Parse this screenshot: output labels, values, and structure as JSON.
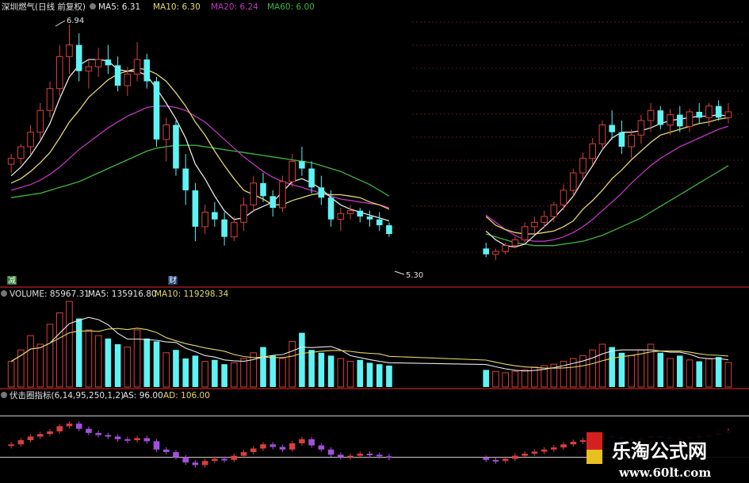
{
  "colors": {
    "up": "#d8403e",
    "down": "#5ff3f3",
    "ma5": "#e8e8e8",
    "ma10": "#e5d96a",
    "ma20": "#c235c2",
    "ma60": "#3fb53f",
    "divider": "#9b1b1b",
    "ref_line": "#d8d8d8",
    "as_purple": "#a34fdc"
  },
  "header": {
    "stock": "深圳燃气(日线 前复权)",
    "ma5": "MA5: 6.31",
    "ma10": "MA10: 6.30",
    "ma20": "MA20: 6.24",
    "ma60": "MA60: 6.00"
  },
  "price_panel": {
    "high_label": "6.94",
    "low_label": "5.30",
    "marker_left": "减",
    "marker_mid": "财"
  },
  "volume_header": {
    "volume": "VOLUME: 85967.31",
    "ma5": "MA5: 135916.80",
    "ma10": "MA10: 119298.34"
  },
  "indicator_header": {
    "name": "伏击圈指标(6,14,95,250,1,2)",
    "as": "AS: 96.00",
    "ad": "AD: 106.00"
  },
  "watermark": {
    "title": "乐淘公式网",
    "url": "www.60lt.com"
  },
  "chart_data": [
    {
      "type": "candlestick",
      "ylim": [
        5.2,
        7.0
      ],
      "annotations": [
        {
          "label": "6.94",
          "value": 6.94
        },
        {
          "label": "5.30",
          "value": 5.3
        }
      ],
      "candles": [
        [
          5.98,
          6.05,
          5.92,
          6.02
        ],
        [
          6.02,
          6.12,
          5.98,
          6.1
        ],
        [
          6.1,
          6.25,
          6.05,
          6.2
        ],
        [
          6.2,
          6.4,
          6.15,
          6.35
        ],
        [
          6.35,
          6.55,
          6.3,
          6.5
        ],
        [
          6.5,
          6.8,
          6.45,
          6.72
        ],
        [
          6.72,
          6.94,
          6.6,
          6.8
        ],
        [
          6.8,
          6.88,
          6.55,
          6.62
        ],
        [
          6.62,
          6.7,
          6.5,
          6.65
        ],
        [
          6.65,
          6.78,
          6.58,
          6.7
        ],
        [
          6.7,
          6.8,
          6.6,
          6.66
        ],
        [
          6.66,
          6.72,
          6.48,
          6.52
        ],
        [
          6.52,
          6.65,
          6.45,
          6.6
        ],
        [
          6.6,
          6.82,
          6.55,
          6.7
        ],
        [
          6.7,
          6.74,
          6.5,
          6.55
        ],
        [
          6.55,
          6.58,
          6.1,
          6.15
        ],
        [
          6.15,
          6.3,
          6.0,
          6.25
        ],
        [
          6.25,
          6.28,
          5.9,
          5.95
        ],
        [
          5.95,
          6.05,
          5.7,
          5.8
        ],
        [
          5.8,
          5.85,
          5.45,
          5.55
        ],
        [
          5.55,
          5.7,
          5.5,
          5.65
        ],
        [
          5.65,
          5.72,
          5.55,
          5.6
        ],
        [
          5.6,
          5.65,
          5.42,
          5.48
        ],
        [
          5.48,
          5.62,
          5.45,
          5.58
        ],
        [
          5.58,
          5.75,
          5.52,
          5.7
        ],
        [
          5.7,
          5.9,
          5.65,
          5.85
        ],
        [
          5.85,
          5.92,
          5.72,
          5.76
        ],
        [
          5.76,
          5.8,
          5.62,
          5.68
        ],
        [
          5.68,
          5.9,
          5.65,
          5.86
        ],
        [
          5.86,
          6.05,
          5.82,
          6.0
        ],
        [
          6.0,
          6.1,
          5.9,
          5.95
        ],
        [
          5.95,
          6.0,
          5.78,
          5.82
        ],
        [
          5.82,
          5.9,
          5.7,
          5.75
        ],
        [
          5.75,
          5.8,
          5.55,
          5.6
        ],
        [
          5.6,
          5.68,
          5.52,
          5.64
        ],
        [
          5.64,
          5.7,
          5.6,
          5.66
        ],
        [
          5.66,
          5.68,
          5.58,
          5.62
        ],
        [
          5.62,
          5.66,
          5.55,
          5.6
        ],
        [
          5.6,
          5.65,
          5.52,
          5.56
        ],
        [
          5.56,
          5.58,
          5.48,
          5.5
        ],
        [
          5.4,
          5.44,
          5.34,
          5.36
        ],
        [
          5.36,
          5.4,
          5.32,
          5.38
        ],
        [
          5.38,
          5.44,
          5.36,
          5.42
        ],
        [
          5.42,
          5.48,
          5.4,
          5.46
        ],
        [
          5.46,
          5.58,
          5.44,
          5.55
        ],
        [
          5.55,
          5.62,
          5.5,
          5.58
        ],
        [
          5.58,
          5.66,
          5.54,
          5.62
        ],
        [
          5.62,
          5.72,
          5.58,
          5.7
        ],
        [
          5.7,
          5.84,
          5.66,
          5.8
        ],
        [
          5.8,
          5.95,
          5.76,
          5.92
        ],
        [
          5.92,
          6.06,
          5.88,
          6.02
        ],
        [
          6.02,
          6.16,
          5.98,
          6.12
        ],
        [
          6.12,
          6.28,
          6.08,
          6.25
        ],
        [
          6.25,
          6.35,
          6.15,
          6.2
        ],
        [
          6.2,
          6.28,
          6.05,
          6.1
        ],
        [
          6.1,
          6.22,
          6.02,
          6.18
        ],
        [
          6.18,
          6.32,
          6.12,
          6.28
        ],
        [
          6.28,
          6.4,
          6.2,
          6.35
        ],
        [
          6.35,
          6.38,
          6.22,
          6.25
        ],
        [
          6.25,
          6.36,
          6.18,
          6.32
        ],
        [
          6.32,
          6.38,
          6.2,
          6.24
        ],
        [
          6.24,
          6.36,
          6.2,
          6.34
        ],
        [
          6.34,
          6.4,
          6.26,
          6.3
        ],
        [
          6.3,
          6.4,
          6.24,
          6.38
        ],
        [
          6.38,
          6.42,
          6.28,
          6.3
        ],
        [
          6.3,
          6.4,
          6.26,
          6.34
        ]
      ],
      "gaps_after_index": [
        39
      ],
      "series": [
        {
          "name": "MA5",
          "values": [
            5.9,
            5.96,
            6.04,
            6.14,
            6.26,
            6.43,
            6.58,
            6.66,
            6.7,
            6.7,
            6.69,
            6.63,
            6.62,
            6.62,
            6.59,
            6.5,
            6.4,
            6.29,
            6.16,
            5.98,
            5.88,
            5.76,
            5.66,
            5.6,
            5.61,
            5.66,
            5.69,
            5.72,
            5.79,
            5.86,
            5.88,
            5.85,
            5.81,
            5.75,
            5.7,
            5.67,
            5.65,
            5.63,
            5.61,
            5.59,
            5.52,
            5.46,
            5.42,
            5.41,
            5.43,
            5.49,
            5.55,
            5.61,
            5.68,
            5.76,
            5.87,
            5.97,
            6.08,
            6.16,
            6.2,
            6.2,
            6.21,
            6.23,
            6.26,
            6.28,
            6.29,
            6.3,
            6.31,
            6.31,
            6.32,
            6.31
          ]
        },
        {
          "name": "MA10",
          "values": [
            5.85,
            5.88,
            5.93,
            5.99,
            6.06,
            6.16,
            6.27,
            6.35,
            6.44,
            6.5,
            6.56,
            6.6,
            6.62,
            6.64,
            6.63,
            6.6,
            6.55,
            6.47,
            6.38,
            6.27,
            6.18,
            6.07,
            5.97,
            5.88,
            5.8,
            5.77,
            5.74,
            5.7,
            5.7,
            5.73,
            5.75,
            5.77,
            5.78,
            5.77,
            5.77,
            5.76,
            5.75,
            5.72,
            5.7,
            5.67,
            5.62,
            5.56,
            5.53,
            5.51,
            5.5,
            5.5,
            5.51,
            5.52,
            5.55,
            5.59,
            5.67,
            5.73,
            5.8,
            5.88,
            5.94,
            6.01,
            6.07,
            6.13,
            6.18,
            6.2,
            6.22,
            6.24,
            6.26,
            6.27,
            6.29,
            6.3
          ]
        },
        {
          "name": "MA20",
          "values": [
            5.8,
            5.82,
            5.84,
            5.87,
            5.91,
            5.96,
            6.02,
            6.08,
            6.13,
            6.18,
            6.23,
            6.27,
            6.31,
            6.34,
            6.37,
            6.38,
            6.38,
            6.37,
            6.35,
            6.31,
            6.27,
            6.21,
            6.15,
            6.09,
            6.03,
            5.98,
            5.93,
            5.89,
            5.86,
            5.84,
            5.82,
            5.8,
            5.78,
            5.76,
            5.74,
            5.73,
            5.72,
            5.71,
            5.7,
            5.68,
            5.63,
            5.58,
            5.53,
            5.49,
            5.46,
            5.45,
            5.45,
            5.46,
            5.48,
            5.51,
            5.55,
            5.6,
            5.66,
            5.72,
            5.78,
            5.85,
            5.91,
            5.97,
            6.02,
            6.06,
            6.1,
            6.13,
            6.16,
            6.19,
            6.22,
            6.24
          ]
        },
        {
          "name": "MA60",
          "values": [
            5.75,
            5.76,
            5.77,
            5.78,
            5.8,
            5.82,
            5.84,
            5.86,
            5.89,
            5.92,
            5.95,
            5.98,
            6.01,
            6.04,
            6.07,
            6.09,
            6.1,
            6.11,
            6.11,
            6.11,
            6.1,
            6.09,
            6.08,
            6.07,
            6.06,
            6.05,
            6.04,
            6.03,
            6.02,
            6.01,
            6.0,
            5.99,
            5.97,
            5.95,
            5.93,
            5.9,
            5.87,
            5.84,
            5.8,
            5.76,
            5.5,
            5.48,
            5.46,
            5.44,
            5.43,
            5.42,
            5.42,
            5.42,
            5.43,
            5.44,
            5.45,
            5.47,
            5.49,
            5.52,
            5.55,
            5.58,
            5.61,
            5.65,
            5.69,
            5.73,
            5.77,
            5.81,
            5.85,
            5.89,
            5.93,
            5.97
          ]
        }
      ]
    },
    {
      "type": "bar",
      "title": "VOLUME",
      "ylim": [
        0,
        300000
      ],
      "values": [
        90000,
        130000,
        180000,
        150000,
        220000,
        260000,
        300000,
        240000,
        200000,
        180000,
        170000,
        150000,
        140000,
        200000,
        170000,
        160000,
        120000,
        130000,
        100000,
        110000,
        90000,
        95000,
        80000,
        85000,
        100000,
        120000,
        140000,
        110000,
        100000,
        160000,
        190000,
        130000,
        120000,
        110000,
        100000,
        90000,
        95000,
        85000,
        80000,
        75000,
        60000,
        55000,
        50000,
        55000,
        60000,
        70000,
        75000,
        80000,
        90000,
        100000,
        110000,
        130000,
        150000,
        140000,
        120000,
        110000,
        130000,
        150000,
        120000,
        100000,
        110000,
        95000,
        90000,
        100000,
        105000,
        85967
      ]
    },
    {
      "type": "bar",
      "title": "伏击圈指标",
      "ylim": [
        0,
        150
      ],
      "reference_lines": [
        125,
        45
      ],
      "series": [
        {
          "name": "AS",
          "values": [
            70,
            78,
            85,
            90,
            95,
            105,
            110,
            100,
            92,
            88,
            85,
            80,
            78,
            82,
            76,
            60,
            55,
            45,
            35,
            30,
            38,
            42,
            40,
            48,
            55,
            62,
            70,
            65,
            60,
            72,
            80,
            68,
            60,
            50,
            45,
            48,
            52,
            50,
            47,
            44,
            40,
            38,
            42,
            48,
            52,
            56,
            60,
            64,
            70,
            75,
            78,
            82,
            86,
            84,
            80,
            78,
            82,
            86,
            84,
            80,
            82,
            84,
            86,
            88,
            92,
            96
          ]
        }
      ]
    }
  ]
}
